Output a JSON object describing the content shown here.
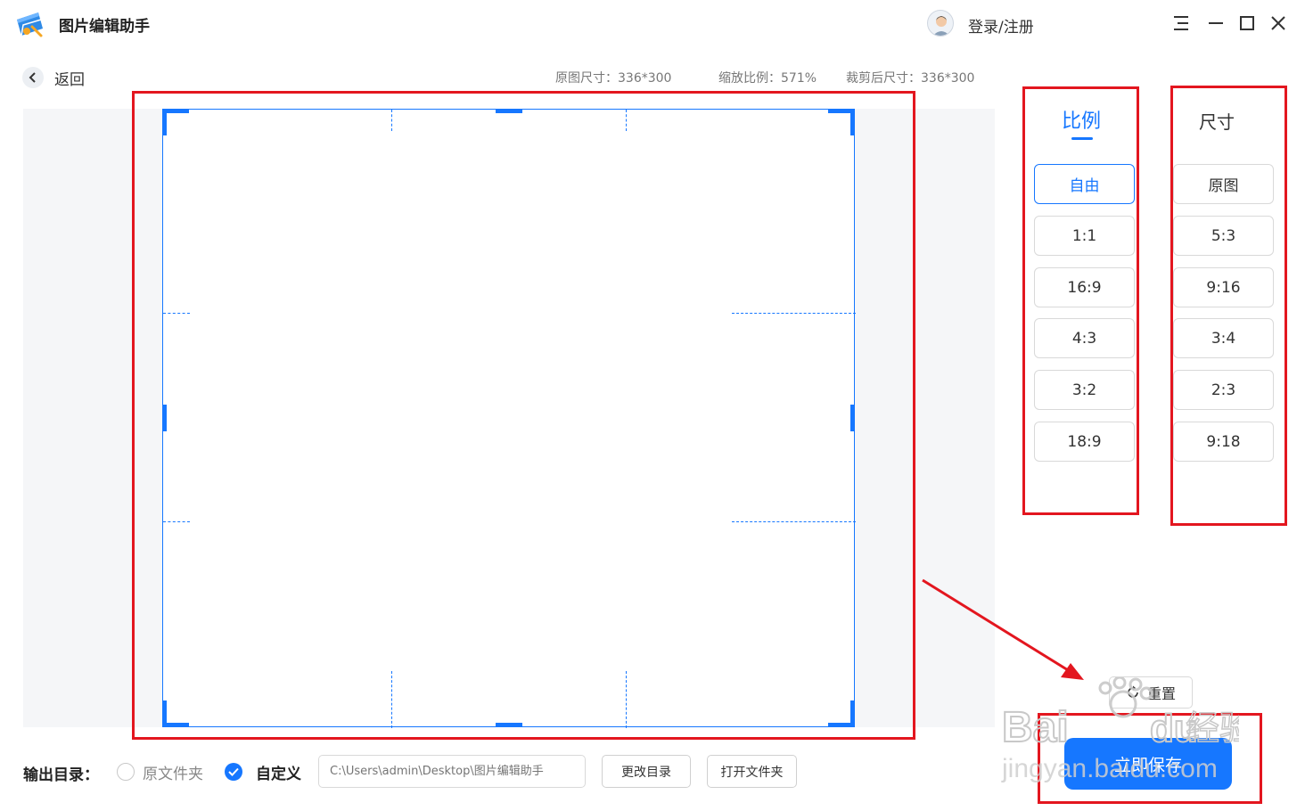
{
  "app": {
    "title": "图片编辑助手",
    "login": "登录/注册"
  },
  "toolbar": {
    "back_label": "返回"
  },
  "info": {
    "original_size": "原图尺寸：336*300",
    "zoom": "缩放比例：571%",
    "cropped_size": "裁剪后尺寸：336*300"
  },
  "ratio_panel": {
    "title": "比例",
    "options": [
      "自由",
      "1:1",
      "16:9",
      "4:3",
      "3:2",
      "18:9"
    ],
    "selected": "自由"
  },
  "size_panel": {
    "title": "尺寸",
    "options": [
      "原图",
      "5:3",
      "9:16",
      "3:4",
      "2:3",
      "9:18"
    ]
  },
  "actions": {
    "reset_label": "重置",
    "save_label": "立即保存"
  },
  "output": {
    "label": "输出目录：",
    "option_original": "原文件夹",
    "option_custom": "自定义",
    "path_placeholder": "C:\\Users\\admin\\Desktop\\图片编辑助手",
    "change_dir": "更改目录",
    "open_folder": "打开文件夹"
  },
  "colors": {
    "accent": "#1677ff",
    "annotation": "#e3161f"
  },
  "watermark": {
    "brand": "Baidu经验",
    "url": "jingyan.baidu.com"
  }
}
